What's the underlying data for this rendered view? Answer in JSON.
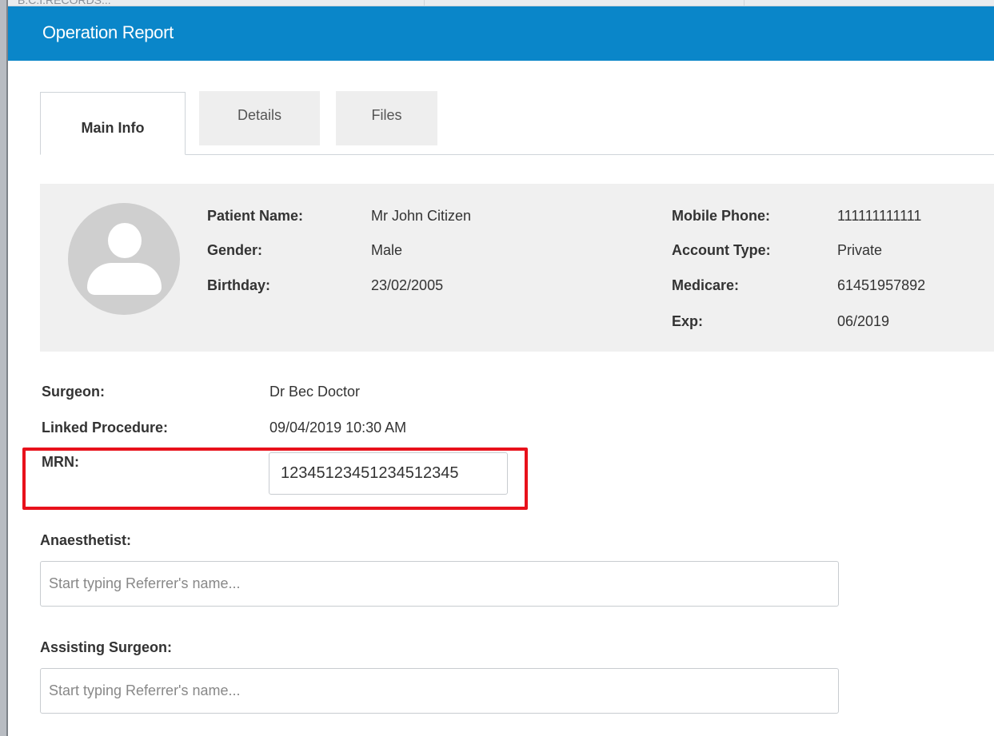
{
  "background": {
    "partial_text": "B.C.I.RECORDS..."
  },
  "modal": {
    "title": "Operation Report",
    "header_color": "#0a86c9"
  },
  "tabs": [
    {
      "label": "Main Info",
      "active": true
    },
    {
      "label": "Details",
      "active": false
    },
    {
      "label": "Files",
      "active": false
    }
  ],
  "patient": {
    "avatar_icon": "user-avatar-icon",
    "left": [
      {
        "label": "Patient Name:",
        "value": "Mr John Citizen"
      },
      {
        "label": "Gender:",
        "value": "Male"
      },
      {
        "label": "Birthday:",
        "value": "23/02/2005"
      }
    ],
    "right": [
      {
        "label": "Mobile Phone:",
        "value": "111111111111"
      },
      {
        "label": "Account Type:",
        "value": "Private"
      },
      {
        "label": "Medicare:",
        "value": "61451957892"
      },
      {
        "label": "Exp:",
        "value": "06/2019"
      }
    ]
  },
  "details": {
    "surgeon_label": "Surgeon:",
    "surgeon_value": "Dr Bec Doctor",
    "linked_label": "Linked Procedure:",
    "linked_value": "09/04/2019 10:30 AM",
    "mrn_label": "MRN:",
    "mrn_value": "12345123451234512345",
    "highlight_color": "#e8111b"
  },
  "anaesthetist": {
    "label": "Anaesthetist:",
    "placeholder": "Start typing Referrer's name..."
  },
  "assisting_surgeon": {
    "label": "Assisting Surgeon:",
    "placeholder": "Start typing Referrer's name..."
  }
}
